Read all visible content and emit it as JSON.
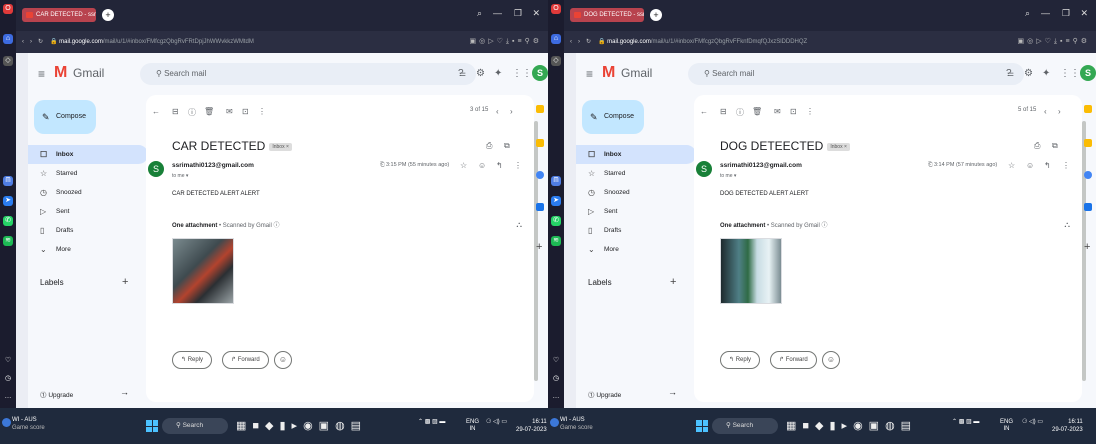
{
  "screens": [
    {
      "tab_title": "CAR DETECTED - ssrimat",
      "url_domain": "mail.google.com",
      "url_rest": "/mail/u/1/#inbox/FMfcgzQbgRvFRtDpjJhWWvkkzWMtdM",
      "app_name": "Gmail",
      "search_placeholder": "Search mail",
      "compose_label": "Compose",
      "nav": [
        "Inbox",
        "Starred",
        "Snoozed",
        "Sent",
        "Drafts",
        "More"
      ],
      "labels_heading": "Labels",
      "upgrade_label": "Upgrade",
      "pager": "3 of 15",
      "subject": "CAR DETECTED",
      "inbox_chip": "Inbox ×",
      "sender": "ssrimathi0123@gmail.com",
      "to_me": "to me ▾",
      "time": "3:15 PM (55 minutes ago)",
      "body": "CAR DETECTED ALERT ALERT",
      "attach_label": "One attachment",
      "attach_scan": " • Scanned by Gmail ⓘ",
      "reply_label": "↰ Reply",
      "forward_label": "↱ Forward",
      "avatar_letter": "S",
      "sender_letter": "S"
    },
    {
      "tab_title": "DOG DETECTED - ssrimat",
      "url_domain": "mail.google.com",
      "url_rest": "/mail/u/1/#inbox/FMfcgzQbgRvFFknfDmqfQJxzSlDDDHQZ",
      "app_name": "Gmail",
      "search_placeholder": "Search mail",
      "compose_label": "Compose",
      "nav": [
        "Inbox",
        "Starred",
        "Snoozed",
        "Sent",
        "Drafts",
        "More"
      ],
      "labels_heading": "Labels",
      "upgrade_label": "Upgrade",
      "pager": "5 of 15",
      "subject": "DOG DETEECTED",
      "inbox_chip": "Inbox ×",
      "sender": "ssrimathi0123@gmail.com",
      "to_me": "to me ▾",
      "time": "3:14 PM (57 minutes ago)",
      "body": "DOG DETECTED ALERT ALERT",
      "attach_label": "One attachment",
      "attach_scan": " • Scanned by Gmail ⓘ",
      "reply_label": "↰ Reply",
      "forward_label": "↱ Forward",
      "avatar_letter": "S",
      "sender_letter": "S"
    }
  ],
  "taskbar": {
    "weather_title": "WI - AUS",
    "weather_sub": "Game score",
    "search_label": "Search",
    "lang_line1": "ENG",
    "lang_line2": "IN",
    "time_left": "16:11",
    "date_left": "29-07-2023",
    "time_right": "16:11",
    "date_right": "29-07-2023"
  },
  "colors": {
    "compose_bg": "#c2e7ff",
    "inbox_active": "#d3e3fd",
    "tab_active": "#b8434e",
    "taskbar": "#1f2a3d"
  },
  "icons": [
    "hamburger-icon",
    "gmail-logo-icon",
    "search-icon",
    "filter-icon",
    "help-icon",
    "settings-icon",
    "gemini-icon",
    "apps-icon",
    "pencil-icon",
    "inbox-icon",
    "star-icon",
    "clock-icon",
    "send-icon",
    "draft-icon",
    "chevron-down-icon",
    "back-arrow-icon",
    "archive-icon",
    "report-icon",
    "delete-icon",
    "mail-icon",
    "move-icon",
    "more-vert-icon",
    "print-icon",
    "open-new-icon",
    "reply-icon",
    "emoji-icon",
    "drive-icon"
  ]
}
